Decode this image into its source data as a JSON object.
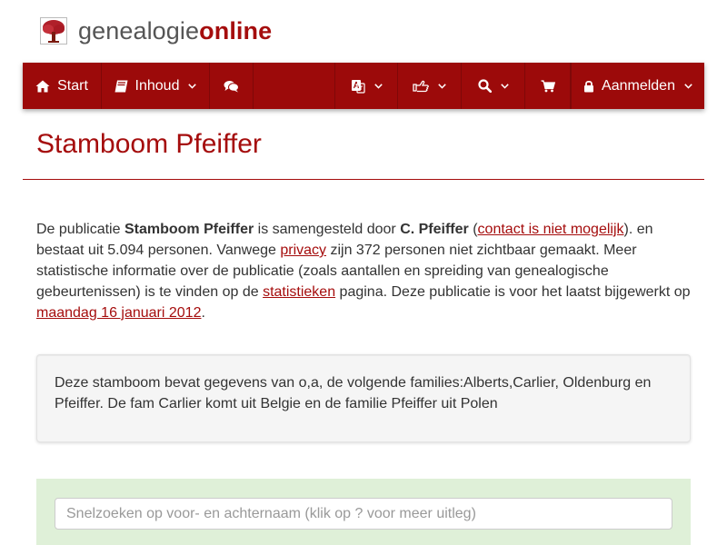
{
  "brand": {
    "name_part1": "genealogie",
    "name_part2": "online",
    "logo_icon": "tree-icon"
  },
  "nav": {
    "start_label": "Start",
    "inhoud_label": "Inhoud",
    "login_label": "Aanmelden",
    "icons": [
      "home-icon",
      "book-icon",
      "comments-icon",
      "language-icon",
      "hand-pointer-icon",
      "search-icon",
      "cart-icon",
      "lock-icon",
      "chevron-down-icon"
    ]
  },
  "page": {
    "title": "Stamboom Pfeiffer"
  },
  "intro": {
    "t1": "De publicatie ",
    "pub_name": "Stamboom Pfeiffer",
    "t2": " is samengesteld door ",
    "author": "C. Pfeiffer",
    "t3": " (",
    "contact_link": "contact is niet mogelijk",
    "t4": "). en bestaat uit 5.094 personen. Vanwege ",
    "privacy_link": "privacy",
    "t5": " zijn 372 personen niet zichtbaar gemaakt. Meer statistische informatie over de publicatie (zoals aantallen en spreiding van genealogische gebeurtenissen) is te vinden op de ",
    "stats_link": "statistieken",
    "t6": " pagina. Deze publicatie is voor het laatst bijgewerkt op ",
    "date_link": "maandag 16 januari 2012",
    "t7": "."
  },
  "description": "Deze stamboom bevat gegevens van o,a, de volgende families:Alberts,Carlier, Oldenburg en Pfeiffer. De fam Carlier komt uit Belgie en de familie Pfeiffer uit Polen",
  "search": {
    "placeholder": "Snelzoeken op voor- en achternaam (klik op ? voor meer uitleg)",
    "value": ""
  },
  "colors": {
    "brand": "#9c0a0a",
    "accent_text": "#a50d0d",
    "search_panel_bg": "#dff0d8",
    "well_bg": "#f5f5f5"
  }
}
